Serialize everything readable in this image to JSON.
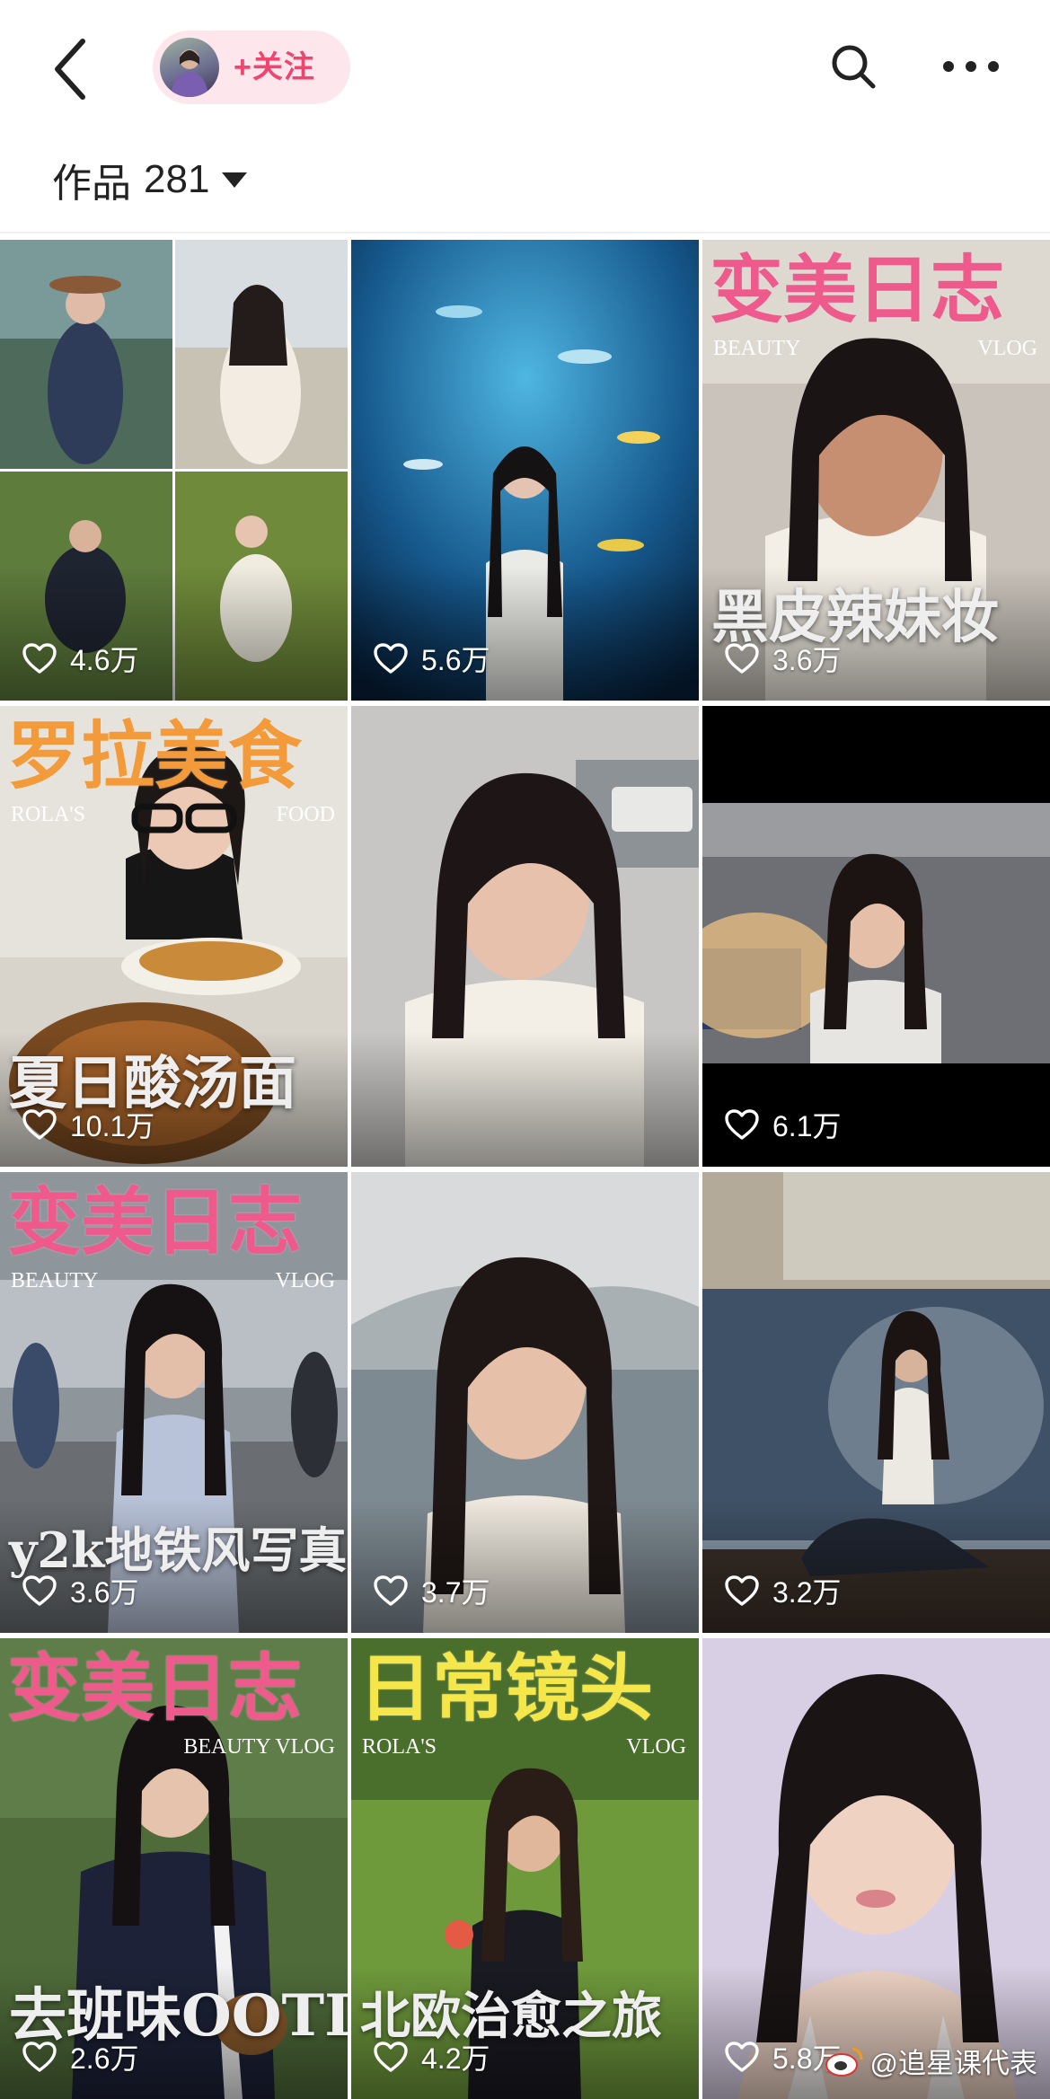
{
  "header": {
    "follow_label": "+关注"
  },
  "filter": {
    "label": "作品",
    "count": "281"
  },
  "accent": "#f0456e",
  "grid": [
    {
      "likes": "4.6万"
    },
    {
      "likes": "5.6万"
    },
    {
      "likes": "3.6万",
      "title_top": "变美日志",
      "sub_left": "BEAUTY",
      "sub_right": "VLOG",
      "title_bottom": "黑皮辣妹妆"
    },
    {
      "likes": "10.1万",
      "title_top": "罗拉美食",
      "sub_left": "ROLA'S",
      "sub_right": "FOOD",
      "title_bottom": "夏日酸汤面"
    },
    {
      "likes": ""
    },
    {
      "likes": "6.1万"
    },
    {
      "likes": "3.6万",
      "title_top": "变美日志",
      "sub_left": "BEAUTY",
      "sub_right": "VLOG",
      "title_bottom": "y2k地铁风写真"
    },
    {
      "likes": "3.7万"
    },
    {
      "likes": "3.2万"
    },
    {
      "likes": "2.6万",
      "title_top": "变美日志",
      "sub_left": "",
      "sub_right": "BEAUTY VLOG",
      "title_bottom": "去班味OOTD"
    },
    {
      "likes": "4.2万",
      "title_top": "日常镜头",
      "sub_left": "ROLA'S",
      "sub_right": "VLOG",
      "title_bottom": "北欧治愈之旅"
    },
    {
      "likes": "5.8万"
    }
  ],
  "watermark": {
    "text": "@追星课代表"
  }
}
